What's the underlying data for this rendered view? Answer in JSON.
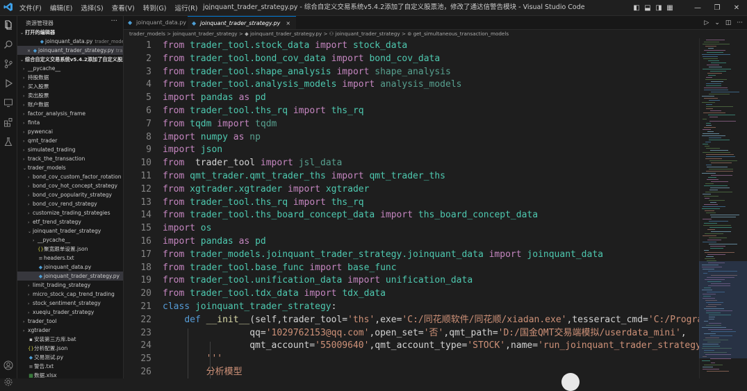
{
  "menu": [
    "文件(F)",
    "编辑(E)",
    "选择(S)",
    "查看(V)",
    "转到(G)",
    "运行(R)",
    "..."
  ],
  "window_title": "joinquant_trader_strategy.py - 综合自定义交易系统v5.4.2添加了自定义股票池，修改了通达信警告模块 - Visual Studio Code",
  "colors": {
    "accent": "#0078d4",
    "keyword": "#c586c0",
    "module": "#4ec9b0",
    "string": "#ce9178",
    "function": "#dcdcaa"
  },
  "sidebar": {
    "header": "资源管理器",
    "open_editors_label": "打开的编辑器",
    "open_editors": [
      {
        "name": "joinquant_data.py",
        "desc": "trader_model..."
      },
      {
        "name": "joinquant_trader_strategy.py",
        "desc": "tra..."
      }
    ],
    "workspace_label": "综合自定义交易系统v5.4.2添加了自定义股票...",
    "tree": [
      {
        "label": "__pycache__",
        "depth": 1,
        "type": "folder"
      },
      {
        "label": "持股数据",
        "depth": 1,
        "type": "folder"
      },
      {
        "label": "买入股票",
        "depth": 1,
        "type": "folder"
      },
      {
        "label": "卖出股票",
        "depth": 1,
        "type": "folder"
      },
      {
        "label": "账户数据",
        "depth": 1,
        "type": "folder"
      },
      {
        "label": "factor_analysis_frame",
        "depth": 1,
        "type": "folder"
      },
      {
        "label": "finta",
        "depth": 1,
        "type": "folder"
      },
      {
        "label": "pywencai",
        "depth": 1,
        "type": "folder"
      },
      {
        "label": "qmt_trader",
        "depth": 1,
        "type": "folder"
      },
      {
        "label": "simulated_trading",
        "depth": 1,
        "type": "folder"
      },
      {
        "label": "track_the_transaction",
        "depth": 1,
        "type": "folder"
      },
      {
        "label": "trader_models",
        "depth": 1,
        "type": "open"
      },
      {
        "label": "bond_cov_custom_factor_rotation",
        "depth": 2,
        "type": "folder"
      },
      {
        "label": "bond_cov_hot_concept_strategy",
        "depth": 2,
        "type": "folder"
      },
      {
        "label": "bond_cov_popularity_strategy",
        "depth": 2,
        "type": "folder"
      },
      {
        "label": "bond_cov_rend_strategy",
        "depth": 2,
        "type": "folder"
      },
      {
        "label": "customize_trading_strategies",
        "depth": 2,
        "type": "folder"
      },
      {
        "label": "etf_trend_strategy",
        "depth": 2,
        "type": "folder"
      },
      {
        "label": "joinquant_trader_strategy",
        "depth": 2,
        "type": "open"
      },
      {
        "label": "__pycache__",
        "depth": 3,
        "type": "folder"
      },
      {
        "label": "聚宽跟单设置.json",
        "depth": 3,
        "type": "json"
      },
      {
        "label": "headers.txt",
        "depth": 3,
        "type": "txt"
      },
      {
        "label": "joinquant_data.py",
        "depth": 3,
        "type": "py"
      },
      {
        "label": "joinquant_trader_strategy.py",
        "depth": 3,
        "type": "py",
        "selected": true
      },
      {
        "label": "limit_trading_strategy",
        "depth": 2,
        "type": "folder"
      },
      {
        "label": "micro_stock_cap_trend_trading",
        "depth": 2,
        "type": "folder"
      },
      {
        "label": "stock_sentiment_strategy",
        "depth": 2,
        "type": "folder"
      },
      {
        "label": "xueqiu_trader_strategy",
        "depth": 2,
        "type": "folder"
      },
      {
        "label": "trader_tool",
        "depth": 1,
        "type": "folder"
      },
      {
        "label": "xgtrader",
        "depth": 1,
        "type": "folder"
      },
      {
        "label": "安装第三方库.bat",
        "depth": 1,
        "type": "bat"
      },
      {
        "label": "分析配置.json",
        "depth": 1,
        "type": "json"
      },
      {
        "label": "交易测试.py",
        "depth": 1,
        "type": "py"
      },
      {
        "label": "警告.txt",
        "depth": 1,
        "type": "txt"
      },
      {
        "label": "数据.xlsx",
        "depth": 1,
        "type": "xlsx"
      }
    ]
  },
  "tabs": [
    {
      "label": "joinquant_data.py",
      "active": false
    },
    {
      "label": "joinquant_trader_strategy.py",
      "active": true,
      "close": "×"
    }
  ],
  "breadcrumbs": [
    "trader_models",
    "joinquant_trader_strategy",
    "joinquant_trader_strategy.py",
    "joinquant_trader_strategy",
    "get_simultaneous_transaction_models"
  ],
  "breadcrumb_sep": ">",
  "code_lines": [
    {
      "n": "1",
      "tokens": [
        [
          "kw",
          "from "
        ],
        [
          "mod",
          "trader_tool.stock_data "
        ],
        [
          "kw",
          "import "
        ],
        [
          "mod",
          "stock_data"
        ]
      ]
    },
    {
      "n": "2",
      "tokens": [
        [
          "kw",
          "from "
        ],
        [
          "mod",
          "trader_tool.bond_cov_data "
        ],
        [
          "kw",
          "import "
        ],
        [
          "mod",
          "bond_cov_data"
        ]
      ]
    },
    {
      "n": "3",
      "tokens": [
        [
          "kw",
          "from "
        ],
        [
          "mod",
          "trader_tool.shape_analysis "
        ],
        [
          "kw",
          "import "
        ],
        [
          "dim",
          "shape_analysis"
        ]
      ]
    },
    {
      "n": "4",
      "tokens": [
        [
          "kw",
          "from "
        ],
        [
          "mod",
          "trader_tool.analysis_models "
        ],
        [
          "kw",
          "import "
        ],
        [
          "dim",
          "analysis_models"
        ]
      ]
    },
    {
      "n": "5",
      "tokens": [
        [
          "kw",
          "import "
        ],
        [
          "mod",
          "pandas "
        ],
        [
          "kw",
          "as "
        ],
        [
          "mod",
          "pd"
        ]
      ]
    },
    {
      "n": "6",
      "tokens": [
        [
          "kw",
          "from "
        ],
        [
          "mod",
          "trader_tool.ths_rq "
        ],
        [
          "kw",
          "import "
        ],
        [
          "mod",
          "ths_rq"
        ]
      ]
    },
    {
      "n": "7",
      "tokens": [
        [
          "kw",
          "from "
        ],
        [
          "mod",
          "tqdm "
        ],
        [
          "kw",
          "import "
        ],
        [
          "dim",
          "tqdm"
        ]
      ]
    },
    {
      "n": "8",
      "tokens": [
        [
          "kw",
          "import "
        ],
        [
          "mod",
          "numpy "
        ],
        [
          "kw",
          "as "
        ],
        [
          "dim",
          "np"
        ]
      ]
    },
    {
      "n": "9",
      "tokens": [
        [
          "kw",
          "import "
        ],
        [
          "mod",
          "json"
        ]
      ]
    },
    {
      "n": "10",
      "tokens": [
        [
          "kw",
          "from "
        ],
        [
          "txt",
          " trader_tool "
        ],
        [
          "kw",
          "import "
        ],
        [
          "dim",
          "jsl_data"
        ]
      ]
    },
    {
      "n": "11",
      "tokens": [
        [
          "kw",
          "from "
        ],
        [
          "mod",
          "qmt_trader.qmt_trader_ths "
        ],
        [
          "kw",
          "import "
        ],
        [
          "mod",
          "qmt_trader_ths"
        ]
      ]
    },
    {
      "n": "12",
      "tokens": [
        [
          "kw",
          "from "
        ],
        [
          "mod",
          "xgtrader.xgtrader "
        ],
        [
          "kw",
          "import "
        ],
        [
          "mod",
          "xgtrader"
        ]
      ]
    },
    {
      "n": "13",
      "tokens": [
        [
          "kw",
          "from "
        ],
        [
          "mod",
          "trader_tool.ths_rq "
        ],
        [
          "kw",
          "import "
        ],
        [
          "mod",
          "ths_rq"
        ]
      ]
    },
    {
      "n": "14",
      "tokens": [
        [
          "kw",
          "from "
        ],
        [
          "mod",
          "trader_tool.ths_board_concept_data "
        ],
        [
          "kw",
          "import "
        ],
        [
          "mod",
          "ths_board_concept_data"
        ]
      ]
    },
    {
      "n": "15",
      "tokens": [
        [
          "kw",
          "import "
        ],
        [
          "mod",
          "os"
        ]
      ]
    },
    {
      "n": "16",
      "tokens": [
        [
          "kw",
          "import "
        ],
        [
          "mod",
          "pandas "
        ],
        [
          "kw",
          "as "
        ],
        [
          "mod",
          "pd"
        ]
      ]
    },
    {
      "n": "17",
      "tokens": [
        [
          "kw",
          "from "
        ],
        [
          "mod",
          "trader_models.joinquant_trader_strategy.joinquant_data "
        ],
        [
          "kw",
          "import "
        ],
        [
          "mod",
          "joinquant_data"
        ]
      ]
    },
    {
      "n": "18",
      "tokens": [
        [
          "kw",
          "from "
        ],
        [
          "mod",
          "trader_tool.base_func "
        ],
        [
          "kw",
          "import "
        ],
        [
          "mod",
          "base_func"
        ]
      ]
    },
    {
      "n": "19",
      "tokens": [
        [
          "kw",
          "from "
        ],
        [
          "mod",
          "trader_tool.unification_data "
        ],
        [
          "kw",
          "import "
        ],
        [
          "mod",
          "unification_data"
        ]
      ]
    },
    {
      "n": "20",
      "tokens": [
        [
          "kw",
          "from "
        ],
        [
          "mod",
          "trader_tool.tdx_data "
        ],
        [
          "kw",
          "import "
        ],
        [
          "mod",
          "tdx_data"
        ]
      ]
    },
    {
      "n": "21",
      "tokens": [
        [
          "kwb",
          "class "
        ],
        [
          "mod",
          "joinquant_trader_strategy"
        ],
        [
          "txt",
          ":"
        ]
      ]
    },
    {
      "n": "22",
      "tokens": [
        [
          "txt",
          "    "
        ],
        [
          "kwb",
          "def "
        ],
        [
          "fn",
          "__init__"
        ],
        [
          "txt",
          "(self,trader_tool="
        ],
        [
          "str",
          "'ths'"
        ],
        [
          "txt",
          ",exe="
        ],
        [
          "str",
          "'C:/同花顺软件/同花顺/xiadan.exe'"
        ],
        [
          "txt",
          ",tesseract_cmd="
        ],
        [
          "str",
          "'C:/Progra"
        ]
      ]
    },
    {
      "n": "23",
      "tokens": [
        [
          "txt",
          "                "
        ],
        [
          "txt",
          "qq="
        ],
        [
          "str",
          "'1029762153@qq.com'"
        ],
        [
          "txt",
          ",open_set="
        ],
        [
          "str",
          "'否'"
        ],
        [
          "txt",
          ",qmt_path="
        ],
        [
          "str",
          "'D:/国金QMT交易端模拟/userdata_mini'"
        ],
        [
          "txt",
          ","
        ]
      ]
    },
    {
      "n": "24",
      "tokens": [
        [
          "txt",
          "                "
        ],
        [
          "txt",
          "qmt_account="
        ],
        [
          "str",
          "'55009640'"
        ],
        [
          "txt",
          ",qmt_account_type="
        ],
        [
          "str",
          "'STOCK'"
        ],
        [
          "txt",
          ",name="
        ],
        [
          "str",
          "'run_joinquant_trader_strategy'"
        ],
        [
          "txt",
          ")"
        ]
      ]
    },
    {
      "n": "25",
      "tokens": [
        [
          "txt",
          "        "
        ],
        [
          "cmt",
          "'''"
        ]
      ]
    },
    {
      "n": "26",
      "tokens": [
        [
          "txt",
          "        "
        ],
        [
          "cmt",
          "分析模型"
        ]
      ]
    }
  ]
}
